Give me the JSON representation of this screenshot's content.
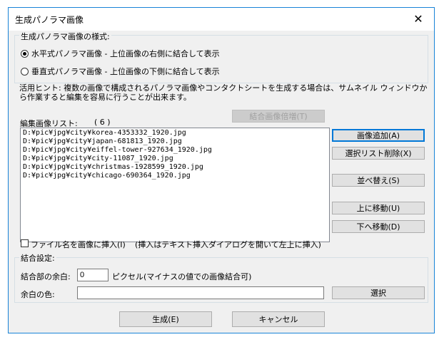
{
  "window": {
    "title": "生成パノラマ画像",
    "close_glyph": "✕"
  },
  "style_group": {
    "label": "生成パノラマ画像の様式:",
    "options": [
      {
        "label": "水平式パノラマ画像 - 上位画像の右側に結合して表示",
        "selected": true
      },
      {
        "label": "垂直式パノラマ画像 - 上位画像の下側に結合して表示",
        "selected": false
      }
    ]
  },
  "hint": {
    "text": "活用ヒント: 複数の画像で構成されるパノラマ画像やコンタクトシートを生成する場合は、サムネイル ウィンドウから作業すると編集を容易に行うことが出来ます。"
  },
  "edit_list": {
    "label": "編集画像リスト:",
    "count": "( 6 )",
    "merge_ratio_button": "結合画像倍増(T)",
    "items": [
      "D:¥pic¥jpg¥city¥korea-4353332_1920.jpg",
      "D:¥pic¥jpg¥city¥japan-681813_1920.jpg",
      "D:¥pic¥jpg¥city¥eiffel-tower-927634_1920.jpg",
      "D:¥pic¥jpg¥city¥city-11087_1920.jpg",
      "D:¥pic¥jpg¥city¥christmas-1928599_1920.jpg",
      "D:¥pic¥jpg¥city¥chicago-690364_1920.jpg"
    ],
    "buttons": {
      "add": "画像追加(A)",
      "remove": "選択リスト削除(X)",
      "sort": "並べ替え(S)",
      "up": "上に移動(U)",
      "down": "下へ移動(D)"
    }
  },
  "insert_filename": {
    "label": "ファイル名を画像に挿入(I)",
    "note": "(挿入はテキスト挿入ダイアログを開いて左上に挿入)",
    "checked": false
  },
  "merge_settings": {
    "label": "結合設定:",
    "margin_label": "結合部の余白:",
    "margin_value": "0",
    "margin_unit": "ピクセル(マイナスの値での画像結合可)",
    "color_label": "余白の色:",
    "color_value": "",
    "choose_button": "選択"
  },
  "footer": {
    "ok": "生成(E)",
    "cancel": "キャンセル"
  }
}
